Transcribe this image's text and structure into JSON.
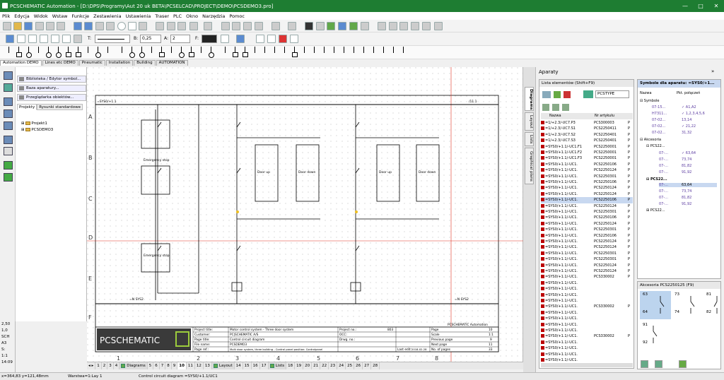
{
  "app": {
    "title": "PCSCHEMATIC Automation - [D:\\DPS\\Programy\\Aut 20 uk BETA\\PCSELCAD\\PROJECT\\DEMO\\PCSDEMO3.pro]",
    "minimize": "—",
    "maximize": "□",
    "close": "✕"
  },
  "menu": [
    "Plik",
    "Edycja",
    "Widok",
    "Wstaw",
    "Funkcje",
    "Zestawienia",
    "Ustawienia",
    "Traser",
    "PLC",
    "Okno",
    "Narzędzia",
    "Pomoc"
  ],
  "toolbar": {
    "line_label": "T:",
    "b_label": "B:",
    "b_value": "0,25",
    "a_label": "A:",
    "a_value": "2",
    "f_label": "F:"
  },
  "category_tabs": [
    "Automation DEMO",
    "Lines etc DEMO",
    "Pneumatic",
    "Installation",
    "Building",
    "AUTOMATION"
  ],
  "left_panel": {
    "buttons": [
      "Biblioteka / Edytor symbol...",
      "Baza aparatury...",
      "Przeglądarka obiektów..."
    ],
    "tabs": [
      "Projekty",
      "Rysunki standardowe"
    ],
    "tree": [
      "Projekt1",
      "PCSDEMO3"
    ]
  },
  "left_status": [
    "2,50",
    "1,0",
    "SCH",
    "A3",
    "S:",
    "1:1",
    "14:09"
  ],
  "drawing": {
    "row_labels": [
      "A",
      "B",
      "C",
      "D",
      "E",
      "F"
    ],
    "col_labels": [
      "1",
      "2",
      "3",
      "4",
      "5",
      "6",
      "7",
      "8"
    ],
    "logo_text": "PCSCHEMATIC",
    "title_block": {
      "project_title_label": "Project title:",
      "project_title": "Motor control system - Three door system",
      "customer_label": "Customer:",
      "customer": "PC|SCHEMATIC A/S",
      "page_title_label": "Page title:",
      "page_title": "Control circuit diagram",
      "file_name_label": "File name:",
      "file_name": "PCSDEMO3",
      "page_ref_label": "Page ref.:",
      "page_ref": "Multi door system, three building - Control panel position: Controlpanel",
      "project_no_label": "Project no.:",
      "project_no": "803",
      "occ_label": "OCC:",
      "drwg_label": "Drwg. no.:",
      "last_edit_label": "Last edit:",
      "last_edit": "2018-02-28",
      "page_label": "Page",
      "page_value": "10",
      "scale_label": "Scale",
      "scale_value": "1:1",
      "prev_page_label": "Previous page",
      "prev_page": "9",
      "next_page_label": "Next page",
      "next_page": "11",
      "no_pages_label": "No. of pages",
      "no_pages": "33",
      "footer": "PCSCHEMATIC Automation"
    }
  },
  "pages": {
    "nav": "◂ ▸",
    "items": [
      "1",
      "2",
      "3",
      "4",
      "Diagrams",
      "5",
      "6",
      "7",
      "8",
      "9",
      "10",
      "11",
      "12",
      "13",
      "Layout",
      "14",
      "15",
      "16",
      "17",
      "Lists",
      "18",
      "19",
      "20",
      "21",
      "22",
      "23",
      "24",
      "25",
      "26",
      "27",
      "28"
    ],
    "active": "10"
  },
  "status_bar": {
    "coords": "x=364,83 y=121,48mm",
    "layer": "Warstwa=1:Lay 1",
    "diagram": "Control circuit diagram =SYS0/+1.1/UC1"
  },
  "side_tabs": [
    "Diagrams",
    "Layout",
    "Lists",
    "Graphical plans"
  ],
  "aparaty": {
    "header": "Aparaty",
    "list_header": "Lista elementów (Shift+F9)",
    "filter": "PCSTYPE",
    "col_name": "Nazwa",
    "col_art": "Nr artykułu",
    "rows": [
      {
        "name": "=1/+2.3/-UC7.P3",
        "art": "PCS300003",
        "t": "P"
      },
      {
        "name": "=1/+2.3/-UC7.S1",
        "art": "PCS2250411",
        "t": "P"
      },
      {
        "name": "=1/+2.3/-UC7.S2",
        "art": "PCS2250401",
        "t": "P"
      },
      {
        "name": "=1/+2.3/-UC7.S3",
        "art": "PCS2250401",
        "t": "P"
      },
      {
        "name": "=SYS0/+1.1/-UC1.F1",
        "art": "PCS2250001",
        "t": "P"
      },
      {
        "name": "=SYS0/+1.1/-UC1.F2",
        "art": "PCS2250001",
        "t": "P"
      },
      {
        "name": "=SYS0/+1.1/-UC1.F3",
        "art": "PCS2250001",
        "t": "P"
      },
      {
        "name": "=SYS0/+1.1/-UC1.",
        "art": "PCS2250106",
        "t": "P"
      },
      {
        "name": "=SYS0/+1.1/-UC1.",
        "art": "PCS2250124",
        "t": "P"
      },
      {
        "name": "=SYS0/+1.1/-UC1.",
        "art": "PCS2250301",
        "t": "P"
      },
      {
        "name": "=SYS0/+1.1/-UC1.",
        "art": "PCS2250106",
        "t": "P"
      },
      {
        "name": "=SYS0/+1.1/-UC1.",
        "art": "PCS2250124",
        "t": "P"
      },
      {
        "name": "=SYS0/+1.1/-UC1.",
        "art": "PCS2250124",
        "t": "P"
      },
      {
        "name": "=SYS0/+1.1/-UC1.",
        "art": "PCS2250106",
        "t": "P"
      },
      {
        "name": "=SYS0/+1.1/-UC1.",
        "art": "PCS2250124",
        "t": "P"
      },
      {
        "name": "=SYS0/+1.1/-UC1.",
        "art": "PCS2250301",
        "t": "P"
      },
      {
        "name": "=SYS0/+1.1/-UC1.",
        "art": "PCS2250106",
        "t": "P"
      },
      {
        "name": "=SYS0/+1.1/-UC1.",
        "art": "PCS2250124",
        "t": "P"
      },
      {
        "name": "=SYS0/+1.1/-UC1.",
        "art": "PCS2250301",
        "t": "P"
      },
      {
        "name": "=SYS0/+1.1/-UC1.",
        "art": "PCS2250106",
        "t": "P"
      },
      {
        "name": "=SYS0/+1.1/-UC1.",
        "art": "PCS2250124",
        "t": "P"
      },
      {
        "name": "=SYS0/+1.1/-UC1.",
        "art": "PCS2250124",
        "t": "P"
      },
      {
        "name": "=SYS0/+1.1/-UC1.",
        "art": "PCS2250301",
        "t": "P"
      },
      {
        "name": "=SYS0/+1.1/-UC1.",
        "art": "PCS2250301",
        "t": "P"
      },
      {
        "name": "=SYS0/+1.1/-UC1.",
        "art": "PCS2250124",
        "t": "P"
      },
      {
        "name": "=SYS0/+1.1/-UC1.",
        "art": "PCS2250124",
        "t": "P"
      },
      {
        "name": "=SYS0/+1.1/-UC1.",
        "art": "PCS330002",
        "t": "P"
      },
      {
        "name": "=SYS0/+1.1/-UC1.",
        "art": "",
        "t": ""
      },
      {
        "name": "=SYS0/+1.1/-UC1.",
        "art": "",
        "t": ""
      },
      {
        "name": "=SYS0/+1.1/-UC1.",
        "art": "",
        "t": ""
      },
      {
        "name": "=SYS0/+1.1/-UC1.",
        "art": "",
        "t": ""
      },
      {
        "name": "=SYS0/+1.1/-UC1.",
        "art": "PCS330002",
        "t": "P"
      },
      {
        "name": "=SYS0/+1.1/-UC1.",
        "art": "",
        "t": ""
      },
      {
        "name": "=SYS0/+1.1/-UC1.",
        "art": "",
        "t": ""
      },
      {
        "name": "=SYS0/+1.1/-UC1.",
        "art": "",
        "t": ""
      },
      {
        "name": "=SYS0/+1.1/-UC1.",
        "art": "",
        "t": ""
      },
      {
        "name": "=SYS0/+1.1/-UC1.",
        "art": "PCS330002",
        "t": "P"
      },
      {
        "name": "=SYS0/+1.1/-UC1.",
        "art": "",
        "t": ""
      },
      {
        "name": "=SYS0/+1.1/-UC1.",
        "art": "",
        "t": ""
      },
      {
        "name": "=SYS0/+1.1/-UC1.",
        "art": "",
        "t": ""
      },
      {
        "name": "=SYS0/+1.1/-UC1.",
        "art": "",
        "t": ""
      }
    ]
  },
  "symbols_panel": {
    "header": "Symbole dla aparatu: =SYS0/+1...",
    "col_name": "Nazwa",
    "col_conn": "Pkt. połączeń",
    "symbole_label": "Symbole",
    "akcesoria_label": "Akcesoria",
    "sym_rows": [
      {
        "n": "07-15...",
        "v": "✓ A1,A2"
      },
      {
        "n": "H7311...",
        "v": "✓ 1,2,3,4,5,6"
      },
      {
        "n": "07-02...",
        "v": "13,14"
      },
      {
        "n": "07-02...",
        "v": "✓ 21,22"
      },
      {
        "n": "07-02...",
        "v": "31,32"
      }
    ],
    "acc1": "PCS22...",
    "acc1_rows": [
      {
        "n": "07-...",
        "v": "✓ 63,64"
      },
      {
        "n": "07-...",
        "v": "73,74"
      },
      {
        "n": "07-...",
        "v": "81,82"
      },
      {
        "n": "07-...",
        "v": "91,92"
      }
    ],
    "acc2": "PCS22...",
    "acc2_rows": [
      {
        "n": "07-...",
        "v": "63,64"
      },
      {
        "n": "07-...",
        "v": "73,74"
      },
      {
        "n": "07-...",
        "v": "81,82"
      },
      {
        "n": "07-...",
        "v": "91,92"
      }
    ],
    "acc3": "PCS22..."
  },
  "akcesoria_panel": {
    "header": "Akcesoria PCS2250125 (F9)",
    "contacts": [
      "63",
      "73",
      "81",
      "64",
      "74",
      "82",
      "91",
      "92"
    ]
  },
  "colors": {
    "titlebar": "#1e7d32",
    "accent_red": "#e03020",
    "selection": "#c8d8f0"
  }
}
